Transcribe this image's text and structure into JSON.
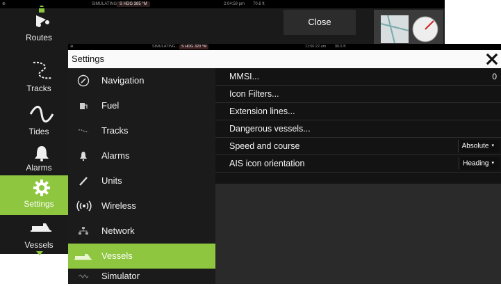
{
  "background_window": {
    "status_left": "SIMULATING...",
    "status_hdg": "S HDG 385 °M",
    "status_time": "2:04:59 pm",
    "status_depth": "70.6 ft",
    "close_label": "Close",
    "sidebar": [
      {
        "label": "Routes",
        "icon": "routes-icon"
      },
      {
        "label": "Tracks",
        "icon": "tracks-icon"
      },
      {
        "label": "Tides",
        "icon": "tides-icon"
      },
      {
        "label": "Alarms",
        "icon": "alarms-icon"
      },
      {
        "label": "Settings",
        "icon": "settings-icon",
        "active": true
      },
      {
        "label": "Vessels",
        "icon": "vessels-icon"
      }
    ]
  },
  "settings_window": {
    "status_left": "SIMULATING...",
    "status_hdg": "S HDG 320 °M",
    "status_time": "11:56:22 am",
    "status_depth": "90.6 ft",
    "title": "Settings",
    "menu": [
      {
        "label": "Navigation",
        "icon": "compass-icon"
      },
      {
        "label": "Fuel",
        "icon": "fuel-icon"
      },
      {
        "label": "Tracks",
        "icon": "tracks-icon"
      },
      {
        "label": "Alarms",
        "icon": "alarm-bell-icon"
      },
      {
        "label": "Units",
        "icon": "units-icon"
      },
      {
        "label": "Wireless",
        "icon": "wireless-icon"
      },
      {
        "label": "Network",
        "icon": "network-icon"
      },
      {
        "label": "Vessels",
        "icon": "vessel-icon",
        "active": true
      },
      {
        "label": "Simulator",
        "icon": "simulator-icon"
      }
    ],
    "rows": [
      {
        "label": "MMSI...",
        "value": "0"
      },
      {
        "label": "Icon Filters..."
      },
      {
        "label": "Extension lines..."
      },
      {
        "label": "Dangerous vessels..."
      },
      {
        "label": "Speed and course",
        "dropdown": "Absolute"
      },
      {
        "label": "AIS icon orientation",
        "dropdown": "Heading"
      }
    ]
  },
  "colors": {
    "accent": "#8ec63f",
    "panel_dark": "#131313",
    "menu_dark": "#1b1b1b",
    "titlebar": "#fafafa"
  }
}
